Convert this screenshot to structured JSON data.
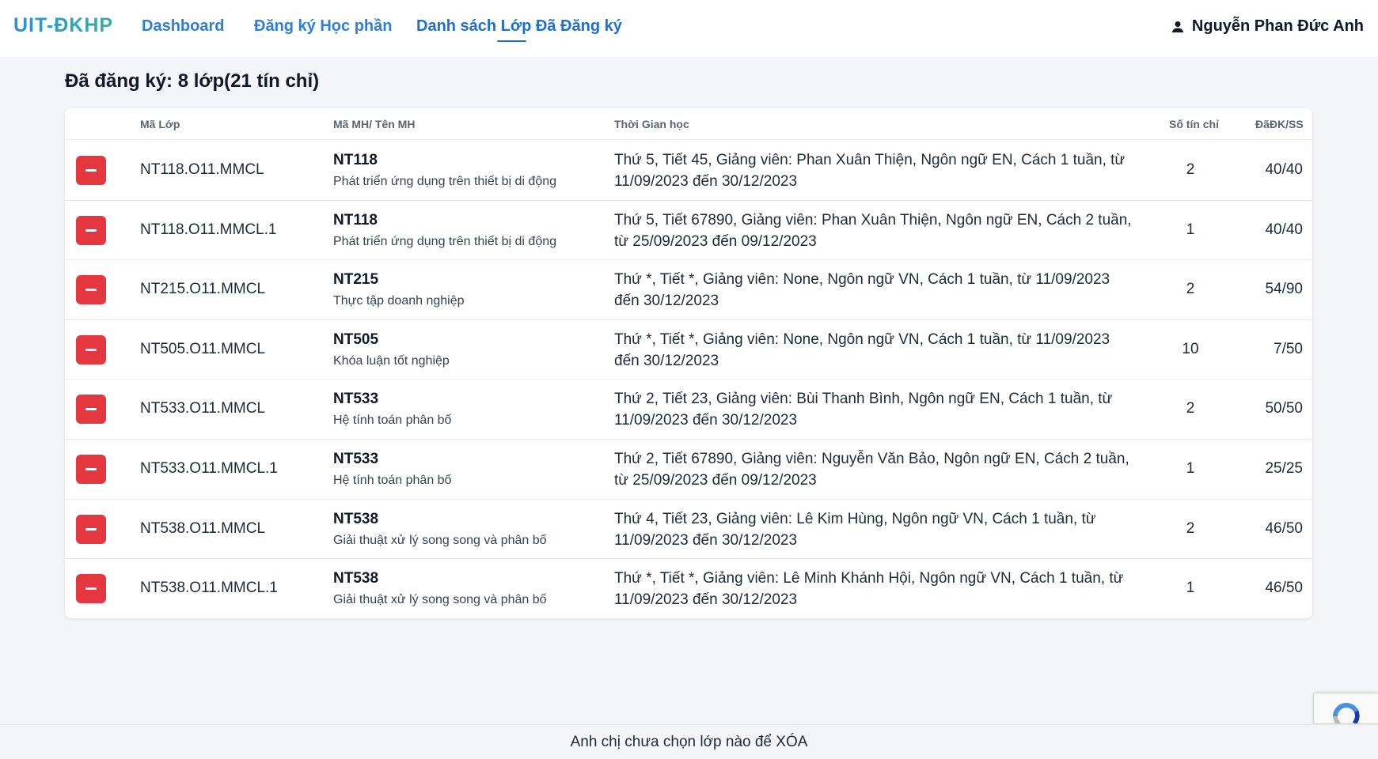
{
  "header": {
    "logo": "UIT-ĐKHP",
    "nav": [
      {
        "label": "Dashboard"
      },
      {
        "label": "Đăng ký Học phần"
      },
      {
        "label": "Danh sách Lớp Đã Đăng ký"
      }
    ],
    "user_name": "Nguyễn Phan Đức Anh"
  },
  "summary": "Đã đăng ký: 8 lớp(21 tín chỉ)",
  "table": {
    "columns": [
      "Mã Lớp",
      "Mã MH/ Tên MH",
      "Thời Gian học",
      "Số tín chỉ",
      "ĐãĐK/SS"
    ],
    "rows": [
      {
        "class_code": "NT118.O11.MMCL",
        "course_code": "NT118",
        "course_name": "Phát triển ứng dụng trên thiết bị di động",
        "time": "Thứ 5, Tiết 45, Giảng viên: Phan Xuân Thiện, Ngôn ngữ EN, Cách 1 tuần, từ 11/09/2023 đến 30/12/2023",
        "credits": "2",
        "registered": "40/40"
      },
      {
        "class_code": "NT118.O11.MMCL.1",
        "course_code": "NT118",
        "course_name": "Phát triển ứng dụng trên thiết bị di động",
        "time": "Thứ 5, Tiết 67890, Giảng viên: Phan Xuân Thiện, Ngôn ngữ EN, Cách 2 tuần, từ 25/09/2023 đến 09/12/2023",
        "credits": "1",
        "registered": "40/40"
      },
      {
        "class_code": "NT215.O11.MMCL",
        "course_code": "NT215",
        "course_name": "Thực tập doanh nghiệp",
        "time": "Thứ *, Tiết *, Giảng viên: None, Ngôn ngữ VN, Cách 1 tuần, từ 11/09/2023 đến 30/12/2023",
        "credits": "2",
        "registered": "54/90"
      },
      {
        "class_code": "NT505.O11.MMCL",
        "course_code": "NT505",
        "course_name": "Khóa luận tốt nghiệp",
        "time": "Thứ *, Tiết *, Giảng viên: None, Ngôn ngữ VN, Cách 1 tuần, từ 11/09/2023 đến 30/12/2023",
        "credits": "10",
        "registered": "7/50"
      },
      {
        "class_code": "NT533.O11.MMCL",
        "course_code": "NT533",
        "course_name": "Hệ tính toán phân bố",
        "time": "Thứ 2, Tiết 23, Giảng viên: Bùi Thanh Bình, Ngôn ngữ EN, Cách 1 tuần, từ 11/09/2023 đến 30/12/2023",
        "credits": "2",
        "registered": "50/50"
      },
      {
        "class_code": "NT533.O11.MMCL.1",
        "course_code": "NT533",
        "course_name": "Hệ tính toán phân bố",
        "time": "Thứ 2, Tiết 67890, Giảng viên: Nguyễn Văn Bảo, Ngôn ngữ EN, Cách 2 tuần, từ 25/09/2023 đến 09/12/2023",
        "credits": "1",
        "registered": "25/25"
      },
      {
        "class_code": "NT538.O11.MMCL",
        "course_code": "NT538",
        "course_name": "Giải thuật xử lý song song và phân bố",
        "time": "Thứ 4, Tiết 23, Giảng viên: Lê Kim Hùng, Ngôn ngữ VN, Cách 1 tuần, từ 11/09/2023 đến 30/12/2023",
        "credits": "2",
        "registered": "46/50"
      },
      {
        "class_code": "NT538.O11.MMCL.1",
        "course_code": "NT538",
        "course_name": "Giải thuật xử lý song song và phân bố",
        "time": "Thứ *, Tiết *, Giảng viên: Lê Minh Khánh Hội, Ngôn ngữ VN, Cách 1 tuần, từ 11/09/2023 đến 30/12/2023",
        "credits": "1",
        "registered": "46/50"
      }
    ]
  },
  "footer_message": "Anh chị chưa chọn lớp nào để XÓA",
  "icons": {
    "user": "user-icon",
    "delete": "minus-icon",
    "recaptcha": "recaptcha-icon"
  },
  "colors": {
    "primary": "#1d6fd8",
    "danger": "#e5373f",
    "background": "#f3f5f9"
  }
}
